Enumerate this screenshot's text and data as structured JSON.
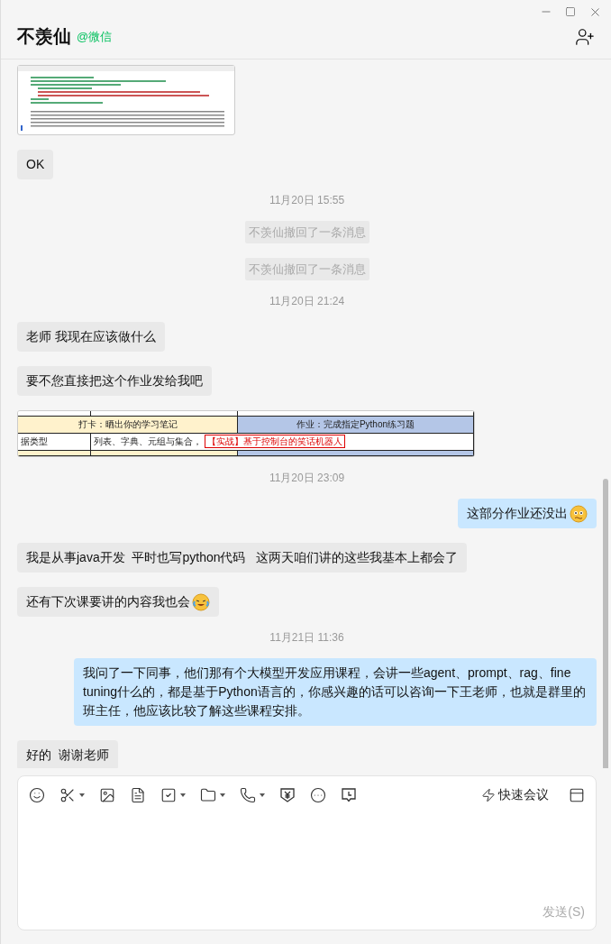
{
  "window": {
    "title": "不羡仙",
    "account": "@微信"
  },
  "messages": [
    {
      "kind": "image"
    },
    {
      "kind": "text",
      "outgoing": false,
      "text": "OK"
    },
    {
      "kind": "time",
      "text": "11月20日 15:55"
    },
    {
      "kind": "recall",
      "text": "不羡仙撤回了一条消息"
    },
    {
      "kind": "recall",
      "text": "不羡仙撤回了一条消息"
    },
    {
      "kind": "time",
      "text": "11月20日 21:24"
    },
    {
      "kind": "text",
      "outgoing": false,
      "text": "老师 我现在应该做什么"
    },
    {
      "kind": "text",
      "outgoing": false,
      "text": "要不您直接把这个作业发给我吧"
    },
    {
      "kind": "table",
      "header": [
        "打卡：晒出你的学习笔记",
        "作业：完成指定Python练习题"
      ],
      "row": [
        "据类型",
        "列表、字典、元组与集合，",
        "【实战】基于控制台的笑话机器人"
      ]
    },
    {
      "kind": "time",
      "text": "11月20日 23:09"
    },
    {
      "kind": "text",
      "outgoing": true,
      "text": "这部分作业还没出",
      "emoji": {
        "kind": "nervous"
      }
    },
    {
      "kind": "text",
      "outgoing": false,
      "text": "我是从事java开发  平时也写python代码   这两天咱们讲的这些我基本上都会了"
    },
    {
      "kind": "text",
      "outgoing": false,
      "text": "还有下次课要讲的内容我也会",
      "emoji": {
        "kind": "laughing"
      }
    },
    {
      "kind": "time",
      "text": "11月21日 11:36"
    },
    {
      "kind": "text",
      "outgoing": true,
      "text": "我问了一下同事，他们那有个大模型开发应用课程，会讲一些agent、prompt、rag、fine tuning什么的，都是基于Python语言的，你感兴趣的话可以咨询一下王老师，也就是群里的班主任，他应该比较了解这些课程安排。"
    },
    {
      "kind": "text",
      "outgoing": false,
      "text": "好的  谢谢老师"
    }
  ],
  "composer": {
    "quick_meeting": "快速会议",
    "send": {
      "label": "发送(S)",
      "disabled": true
    }
  }
}
